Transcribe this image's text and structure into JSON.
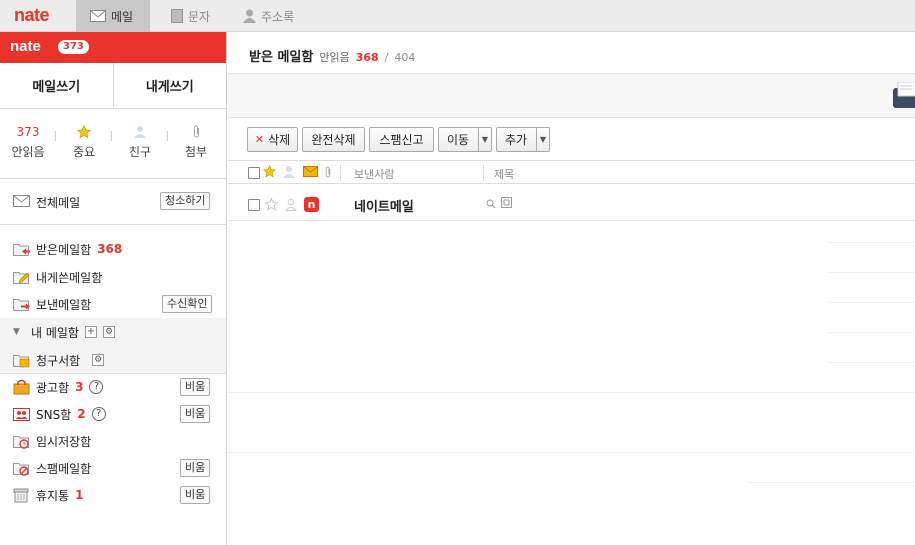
{
  "topbar": {
    "logo": "nate",
    "tabs": [
      {
        "label": "메일",
        "icon": "mail-icon"
      },
      {
        "label": "문자",
        "icon": "sms-icon"
      },
      {
        "label": "주소록",
        "icon": "contact-icon"
      }
    ]
  },
  "sidebar": {
    "logo": "nate",
    "badge": "373",
    "write_mail": "메일쓰기",
    "write_self": "내게쓰기",
    "quick": [
      {
        "value": "373",
        "label": "안읽음"
      },
      {
        "icon": "star-icon",
        "label": "중요"
      },
      {
        "icon": "person-icon",
        "label": "친구"
      },
      {
        "icon": "paperclip-icon",
        "label": "첨부"
      }
    ],
    "all_mail": {
      "label": "전체메일",
      "button": "청소하기"
    },
    "folders": {
      "inbox": {
        "label": "받은메일함",
        "count": "368"
      },
      "self": {
        "label": "내게쓴메일함"
      },
      "sent": {
        "label": "보낸메일함",
        "button": "수신확인"
      },
      "mybox": {
        "label": "내 메일함"
      },
      "bill": {
        "label": "청구서함"
      },
      "ad": {
        "label": "광고함",
        "count": "3",
        "button": "비움"
      },
      "sns": {
        "label": "SNS함",
        "count": "2",
        "button": "비움"
      },
      "draft": {
        "label": "임시저장함"
      },
      "spam": {
        "label": "스팸메일함",
        "button": "비움"
      },
      "trash": {
        "label": "휴지통",
        "count": "1",
        "button": "비움"
      }
    }
  },
  "main": {
    "title": "받은 메일함",
    "unread_label": "안읽음",
    "unread_count": "368",
    "separator": "/",
    "total": "404",
    "toolbar": {
      "delete": "삭제",
      "delete_all": "완전삭제",
      "spam_report": "스팸신고",
      "move": "이동",
      "add": "추가"
    },
    "columns": {
      "sender": "보낸사람",
      "subject": "제목"
    },
    "messages": [
      {
        "sender": "네이트메일",
        "sender_icon": "nate-n-icon"
      }
    ]
  },
  "colors": {
    "accent": "#e8342c",
    "topbar": "#ececec",
    "active_tab": "#c9c9c9"
  }
}
